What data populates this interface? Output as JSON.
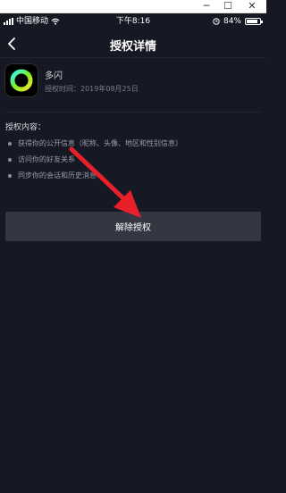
{
  "window": {
    "minimize": "─",
    "maximize": "☐",
    "close": "✕"
  },
  "status_bar": {
    "carrier": "中国移动",
    "time": "下午8:16",
    "battery_percent": "84%",
    "battery_level": 0.84
  },
  "header": {
    "title": "授权详情"
  },
  "app": {
    "name": "多闪",
    "auth_time": "授权时间：2019年08月25日"
  },
  "permissions": {
    "title": "授权内容：",
    "items": [
      {
        "label": "获得你的公开信息（昵称、头像、地区和性别信息）"
      },
      {
        "label": "访问你的好友关系"
      },
      {
        "label": "同步你的会话和历史消息"
      }
    ]
  },
  "revoke_button": {
    "label": "解除授权"
  },
  "colors": {
    "background": "#161823",
    "button": "#343641",
    "annotation_arrow": "#e8202a",
    "app_ring": "#7df224"
  },
  "icons": [
    "back-chevron-icon",
    "signal-icon",
    "wifi-icon",
    "alarm-icon",
    "battery-icon",
    "app-logo-icon"
  ]
}
